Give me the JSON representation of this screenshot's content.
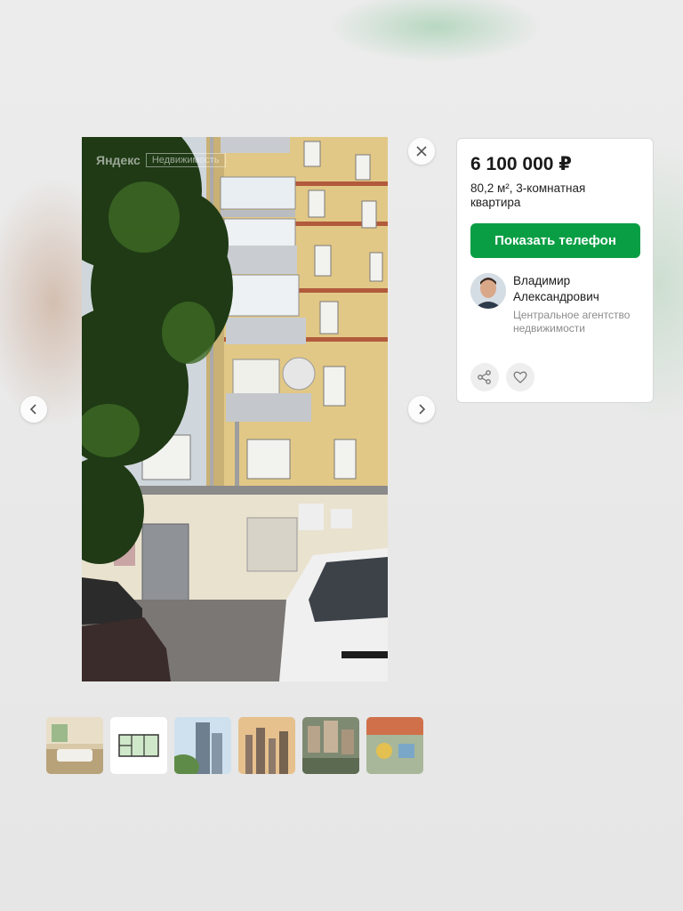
{
  "photo": {
    "watermark_brand": "Яндекс",
    "watermark_box": "Недвижимость"
  },
  "card": {
    "price": "6 100 000 ₽",
    "description": "80,2 м², 3-комнатная квартира",
    "show_phone_label": "Показать телефон",
    "agent_name": "Владимир Александрович",
    "agent_company": "Центральное агентство недвижимости"
  },
  "icons": {
    "close": "close-icon",
    "prev": "chevron-left-icon",
    "next": "chevron-right-icon",
    "share": "share-icon",
    "favorite": "heart-icon"
  },
  "colors": {
    "accent": "#0a9e44",
    "card_bg": "#ffffff",
    "muted_text": "#8c8c8c"
  },
  "thumbnails": [
    {
      "subject": "living-room"
    },
    {
      "subject": "floor-plan"
    },
    {
      "subject": "tower-exterior"
    },
    {
      "subject": "city-skyline"
    },
    {
      "subject": "aerial-block"
    },
    {
      "subject": "playground"
    }
  ]
}
